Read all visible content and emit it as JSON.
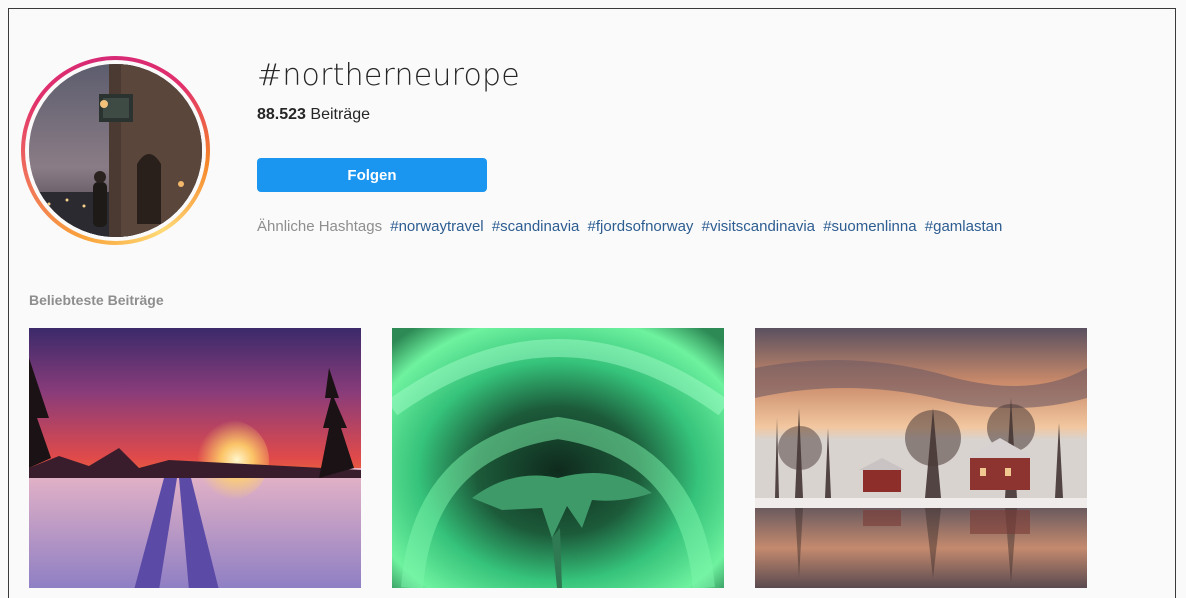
{
  "header": {
    "hashtag": "#northerneurope",
    "post_count": "88.523",
    "post_count_label": "Beiträge",
    "follow_label": "Folgen"
  },
  "related": {
    "label": "Ähnliche Hashtags",
    "tags": [
      "#norwaytravel",
      "#scandinavia",
      "#fjordsofnorway",
      "#visitscandinavia",
      "#suomenlinna",
      "#gamlastan"
    ]
  },
  "top_posts": {
    "title": "Beliebteste Beiträge"
  },
  "colors": {
    "follow_button": "#1a96f0",
    "hashtag_link": "#2d5d91",
    "muted_text": "#8e8e8e"
  }
}
